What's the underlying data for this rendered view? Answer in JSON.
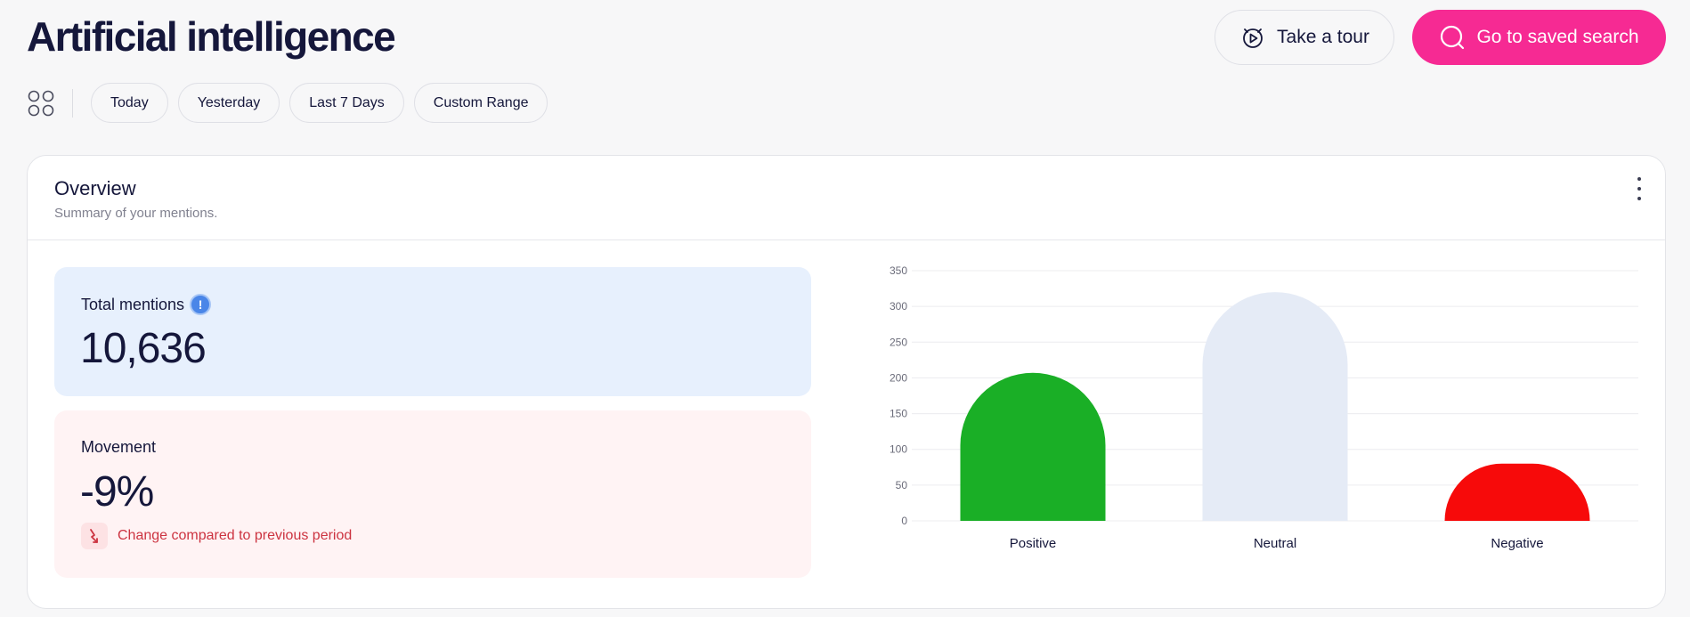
{
  "header": {
    "title": "Artificial intelligence",
    "tour_label": "Take a tour",
    "saved_search_label": "Go to saved search",
    "accent_color": "#f62a93"
  },
  "filters": {
    "items": [
      "Today",
      "Yesterday",
      "Last 7 Days",
      "Custom Range"
    ]
  },
  "overview": {
    "title": "Overview",
    "subtitle": "Summary of your mentions.",
    "total_mentions": {
      "label": "Total mentions",
      "value": "10,636",
      "info_glyph": "!"
    },
    "movement": {
      "label": "Movement",
      "value": "-9%",
      "change_text": "Change compared to previous period"
    }
  },
  "chart_data": {
    "type": "bar",
    "categories": [
      "Positive",
      "Neutral",
      "Negative"
    ],
    "values": [
      207,
      320,
      80
    ],
    "colors": [
      "#1aaf26",
      "#e5ebf6",
      "#f70a0a"
    ],
    "ylim": [
      0,
      350
    ],
    "yticks": [
      0,
      50,
      100,
      150,
      200,
      250,
      300,
      350
    ],
    "grid": true
  }
}
